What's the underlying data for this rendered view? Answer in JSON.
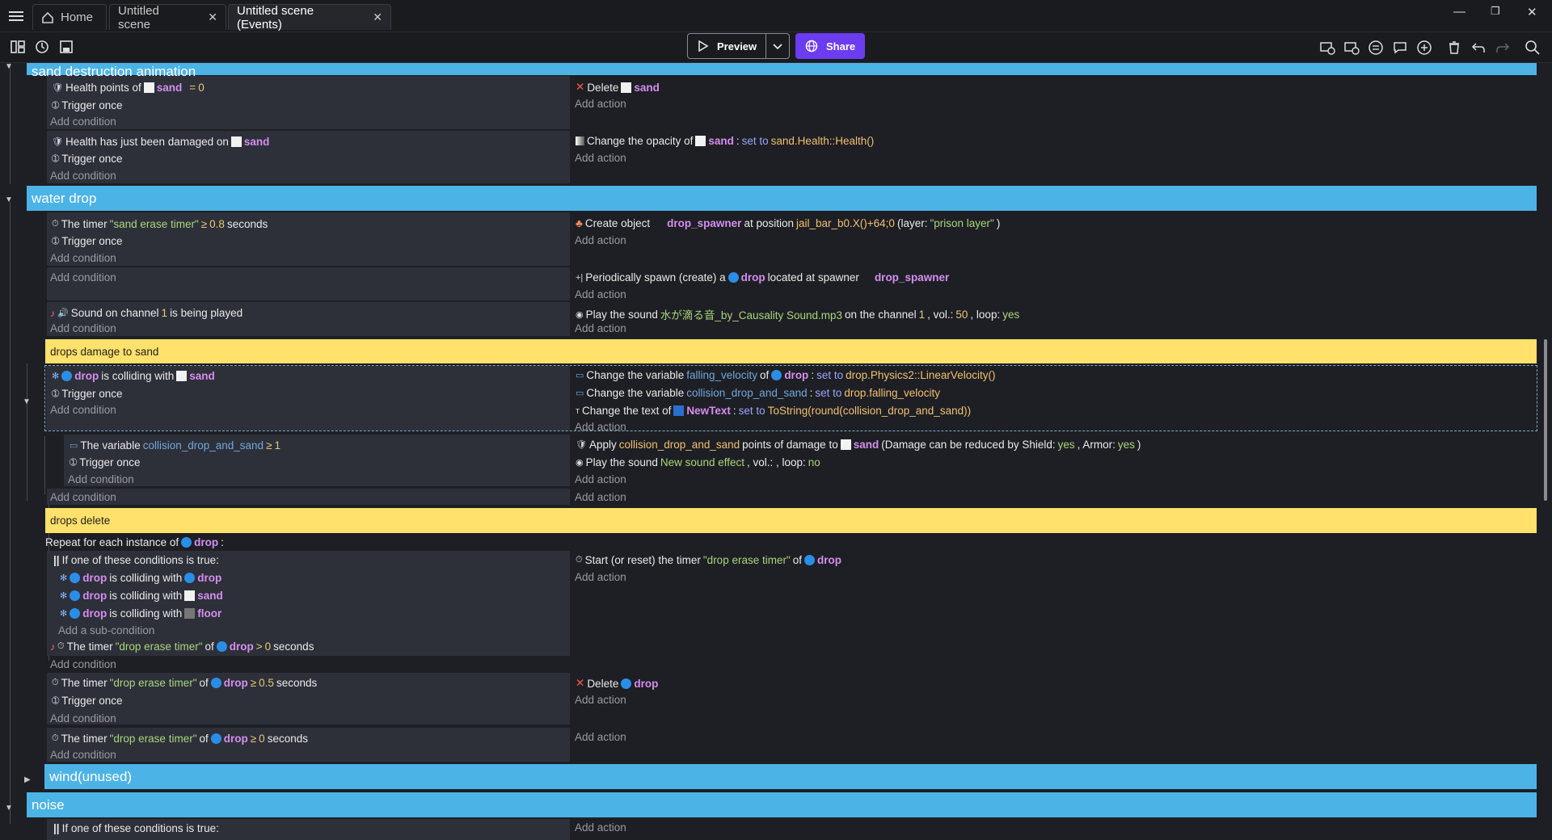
{
  "tabs": {
    "home": "Home",
    "scene": "Untitled scene",
    "events": "Untitled scene (Events)"
  },
  "toolbar": {
    "preview": "Preview",
    "share": "Share"
  },
  "groups": {
    "g1": "sand destruction animation",
    "g2": "water drop",
    "g3": "wind(unused)",
    "g4": "noise"
  },
  "comments": {
    "c1": "drops damage to sand",
    "c2": "drops delete"
  },
  "add": {
    "cond": "Add condition",
    "act": "Add action",
    "sub": "Add a sub-condition"
  },
  "t": {
    "health_points_of": "Health points of",
    "sand": "sand",
    "eq": "= ",
    "zero": "0",
    "trigger_once": "Trigger once",
    "delete": "Delete",
    "health_damaged": "Health has just been damaged on",
    "change_opacity": "Change the opacity of",
    "set_to": "set to",
    "health_expr": "sand.Health::Health()",
    "the_timer": "The timer",
    "sand_erase_timer": "\"sand erase timer\"",
    "gte": "≥",
    "v08": "0.8",
    "seconds": "seconds",
    "create_object": "Create object",
    "drop_spawner": "drop_spawner",
    "at_position": "at position",
    "pos_expr": "jail_bar_b0.X()+64;0",
    "layer_open": "(layer:",
    "prison_layer": "\"prison layer\"",
    "close": ")",
    "periodic_spawn": "Periodically spawn (create) a",
    "drop": "drop",
    "located_at": "located at spawner",
    "sound_on_channel": "Sound on channel",
    "one": "1",
    "being_played": "is being played",
    "play_sound": "Play the sound",
    "sound_file": "水が滴る音_by_Causality Sound.mp3",
    "on_channel": "on the channel",
    "vol": ", vol.:",
    "fifty": "50",
    "loop": ", loop:",
    "yes": "yes",
    "colliding_with": "is colliding with",
    "change_variable": "Change the variable",
    "falling_velocity": "falling_velocity",
    "of": "of",
    "vel_expr": "drop.Physics2::LinearVelocity()",
    "collision_var": "collision_drop_and_sand",
    "fv_expr": "drop.falling_velocity",
    "change_text": "Change the text of",
    "newtext": "NewText",
    "tostring_expr": "ToString(round(collision_drop_and_sand))",
    "the_variable": "The variable",
    "apply": "Apply",
    "points_damage": "points of damage to",
    "dmg_open": "(Damage can be reduced by Shield:",
    "armor": ", Armor:",
    "yes_close": "yes)",
    "new_sound": "New sound effect",
    "vol_empty": ", vol.: , loop:",
    "no": "no",
    "repeat": "Repeat for each instance of",
    "if_one": "If one of these conditions is true:",
    "floor": "floor",
    "drop_erase_timer": "\"drop erase timer\"",
    "gt": ">",
    "v05": "0.5",
    "start_timer": "Start (or reset) the timer"
  },
  "colors": {
    "group": "#4cb3e6",
    "comment": "#ffe16b",
    "object": "#d58ef0",
    "share": "#6c3cf0"
  }
}
